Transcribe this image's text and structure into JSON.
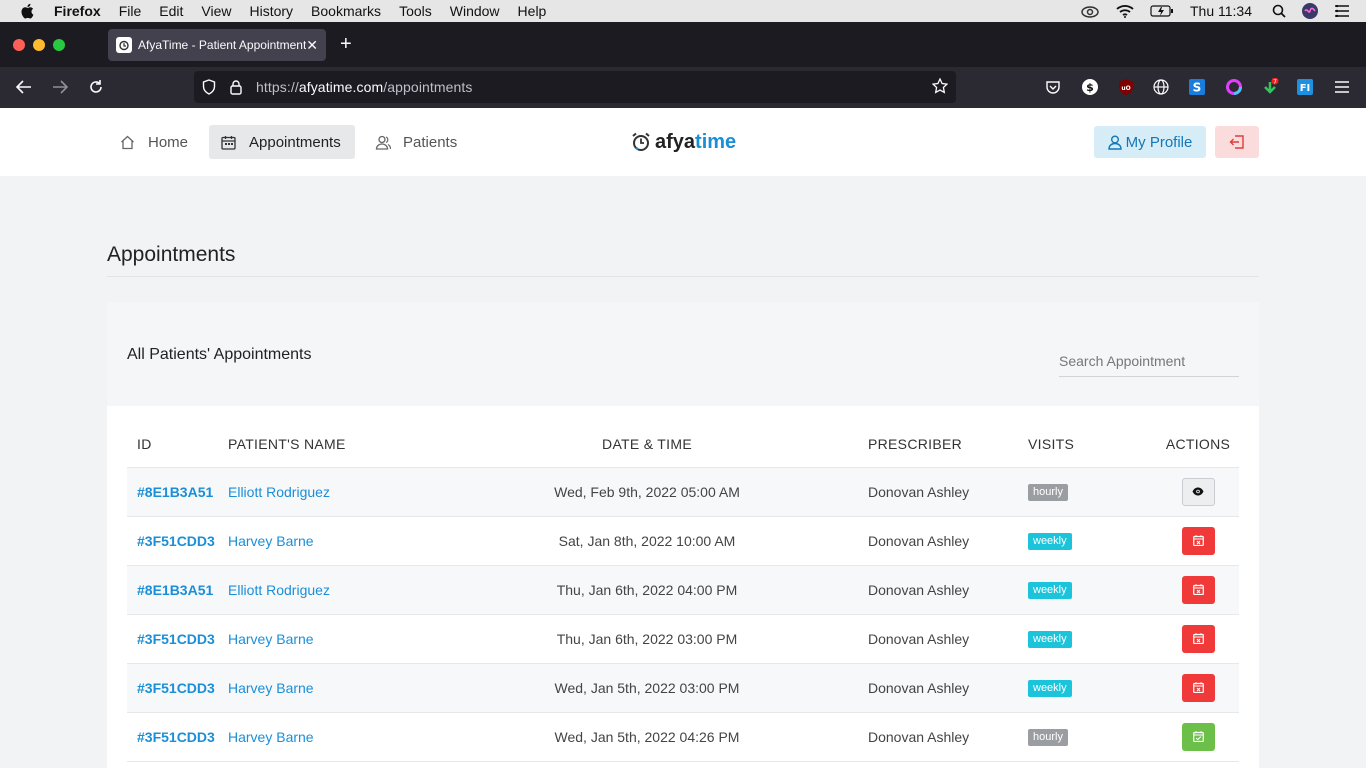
{
  "menubar": {
    "app": "Firefox",
    "items": [
      "File",
      "Edit",
      "View",
      "History",
      "Bookmarks",
      "Tools",
      "Window",
      "Help"
    ],
    "clock": "Thu 11:34"
  },
  "browser": {
    "tab_title": "AfyaTime - Patient Appointments",
    "url_prefix": "https://",
    "url_host": "afyatime.com",
    "url_path": "/appointments"
  },
  "app": {
    "nav": [
      {
        "label": "Home",
        "icon": "home-icon"
      },
      {
        "label": "Appointments",
        "icon": "calendar-icon"
      },
      {
        "label": "Patients",
        "icon": "users-icon"
      }
    ],
    "logo": {
      "part1": "afya",
      "part2": "time"
    },
    "profile_label": "My Profile",
    "accent": "#1a8fd8"
  },
  "page": {
    "title": "Appointments",
    "card_title": "All Patients' Appointments",
    "search_placeholder": "Search Appointment"
  },
  "table": {
    "columns": [
      "ID",
      "PATIENT'S NAME",
      "DATE & TIME",
      "PRESCRIBER",
      "VISITS",
      "ACTIONS"
    ],
    "rows": [
      {
        "id": "#8E1B3A51",
        "name": "Elliott Rodriguez",
        "datetime": "Wed, Feb 9th, 2022 05:00 AM",
        "prescriber": "Donovan Ashley",
        "visits": "hourly",
        "visits_color": "#9a9ea3",
        "action": "view"
      },
      {
        "id": "#3F51CDD3",
        "name": "Harvey Barne",
        "datetime": "Sat, Jan 8th, 2022 10:00 AM",
        "prescriber": "Donovan Ashley",
        "visits": "weekly",
        "visits_color": "#1bc4da",
        "action": "cancel"
      },
      {
        "id": "#8E1B3A51",
        "name": "Elliott Rodriguez",
        "datetime": "Thu, Jan 6th, 2022 04:00 PM",
        "prescriber": "Donovan Ashley",
        "visits": "weekly",
        "visits_color": "#1bc4da",
        "action": "cancel"
      },
      {
        "id": "#3F51CDD3",
        "name": "Harvey Barne",
        "datetime": "Thu, Jan 6th, 2022 03:00 PM",
        "prescriber": "Donovan Ashley",
        "visits": "weekly",
        "visits_color": "#1bc4da",
        "action": "cancel"
      },
      {
        "id": "#3F51CDD3",
        "name": "Harvey Barne",
        "datetime": "Wed, Jan 5th, 2022 03:00 PM",
        "prescriber": "Donovan Ashley",
        "visits": "weekly",
        "visits_color": "#1bc4da",
        "action": "cancel"
      },
      {
        "id": "#3F51CDD3",
        "name": "Harvey Barne",
        "datetime": "Wed, Jan 5th, 2022 04:26 PM",
        "prescriber": "Donovan Ashley",
        "visits": "hourly",
        "visits_color": "#9a9ea3",
        "action": "done"
      }
    ]
  }
}
